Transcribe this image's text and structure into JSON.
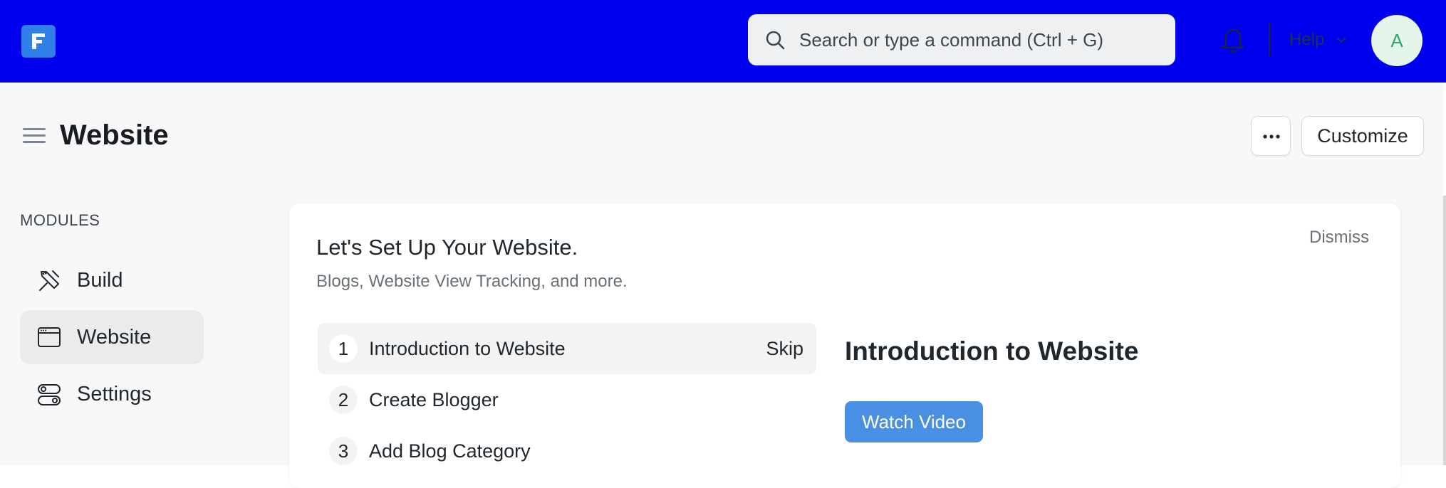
{
  "navbar": {
    "logo_letter": "F",
    "search_placeholder": "Search or type a command (Ctrl + G)",
    "help_label": "Help",
    "avatar_initial": "A",
    "colors": {
      "background": "#0000ee",
      "logo": "#2f7fe8"
    }
  },
  "header": {
    "title": "Website",
    "more_label": "...",
    "customize_label": "Customize"
  },
  "sidebar": {
    "section_label": "MODULES",
    "items": [
      {
        "label": "Build",
        "icon": "tools-icon",
        "active": false
      },
      {
        "label": "Website",
        "icon": "browser-window-icon",
        "active": true
      },
      {
        "label": "Settings",
        "icon": "toggles-icon",
        "active": false
      }
    ]
  },
  "onboarding": {
    "title": "Let's Set Up Your Website.",
    "subtitle": "Blogs, Website View Tracking, and more.",
    "dismiss_label": "Dismiss",
    "steps": [
      {
        "number": "1",
        "label": "Introduction to Website",
        "action": "Skip",
        "active": true
      },
      {
        "number": "2",
        "label": "Create Blogger",
        "active": false
      },
      {
        "number": "3",
        "label": "Add Blog Category",
        "active": false
      }
    ],
    "panel": {
      "title": "Introduction to Website",
      "button_label": "Watch Video",
      "button_color": "#4a90e2"
    }
  }
}
